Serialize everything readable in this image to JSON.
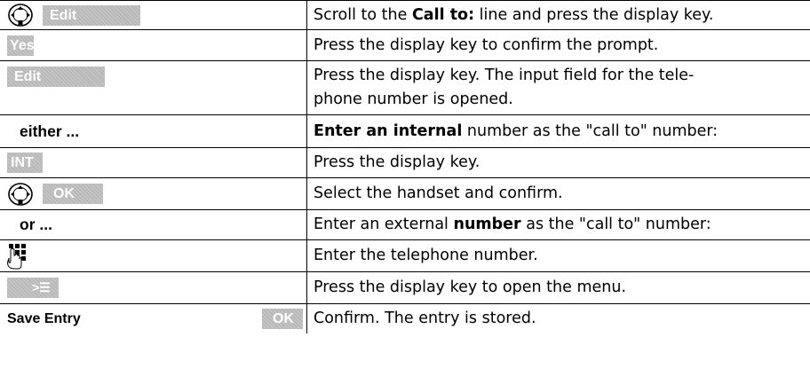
{
  "rows": [
    {
      "left": {
        "softkey": "Edit"
      },
      "right": {
        "pre": "Scroll to the ",
        "bold": "Call to:",
        "post": " line and press the display key."
      }
    },
    {
      "left": {
        "softkey": "Yes"
      },
      "right": {
        "text": "Press the display key to confirm the prompt."
      }
    },
    {
      "left": {
        "softkey": "Edit"
      },
      "right": {
        "line1": "Press the display key. The input field for the tele-",
        "line2": "phone number is opened."
      }
    },
    {
      "left": {
        "text": "either ..."
      },
      "right": {
        "bold": "Enter an internal",
        "post": " number as the \"call to\" number:"
      }
    },
    {
      "left": {
        "softkey": "INT"
      },
      "right": {
        "text": "Press the display key."
      }
    },
    {
      "left": {
        "softkey": "OK"
      },
      "right": {
        "text": "Select the handset and confirm."
      }
    },
    {
      "left": {
        "text": "or ..."
      },
      "right": {
        "pre": "Enter an external ",
        "bold": "number",
        "post": " as the \"call to\" number:"
      }
    },
    {
      "left": {
        "icon": "keypad-icon"
      },
      "right": {
        "text": "Enter the telephone number."
      }
    },
    {
      "left": {
        "softkey": "˃☰"
      },
      "right": {
        "text": "Press the display key to open the menu."
      }
    },
    {
      "left": {
        "text": "Save Entry",
        "softkey": "OK"
      },
      "right": {
        "text": "Confirm. The entry is stored."
      }
    }
  ],
  "icons": {
    "navigation": "navigation-key-icon",
    "keypad": "keypad-icon"
  },
  "colors": {
    "softkey_bg": "#b8b8b8",
    "text": "#000000",
    "border": "#000000"
  }
}
